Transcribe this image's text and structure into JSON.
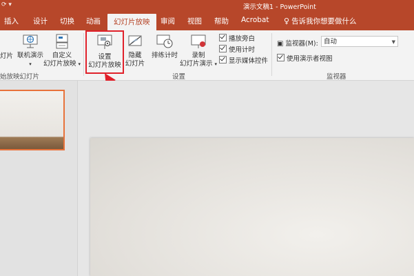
{
  "app": {
    "quick_access": "⟳ ▾",
    "title": "演示文稿1 - PowerPoint"
  },
  "tabs": [
    {
      "label": "插入"
    },
    {
      "label": "设计"
    },
    {
      "label": "切换"
    },
    {
      "label": "动画"
    },
    {
      "label": "幻灯片放映",
      "active": true
    },
    {
      "label": "审阅"
    },
    {
      "label": "视图"
    },
    {
      "label": "帮助"
    },
    {
      "label": "Acrobat"
    }
  ],
  "tell_me": "告诉我你想要做什么",
  "ribbon": {
    "start_group": {
      "from_current_partial": "灯片",
      "online_present": "联机演示",
      "custom_line1": "自定义",
      "custom_line2": "幻灯片放映",
      "label": "始放映幻灯片"
    },
    "setup_group": {
      "setup_line1": "设置",
      "setup_line2": "幻灯片放映",
      "hide_line1": "隐藏",
      "hide_line2": "幻灯片",
      "rehearse": "排练计时",
      "record_line1": "录制",
      "record_line2": "幻灯片演示",
      "checkboxes": [
        "播放旁白",
        "使用计时",
        "显示媒体控件"
      ],
      "label": "设置"
    },
    "monitor_group": {
      "monitor_label": "监视器(M):",
      "monitor_value": "自动",
      "presenter_view": "使用演示者视图",
      "label": "监视器"
    }
  },
  "colors": {
    "accent": "#b7472a",
    "highlight": "#e0202a",
    "thumb_border": "#e8723a"
  }
}
